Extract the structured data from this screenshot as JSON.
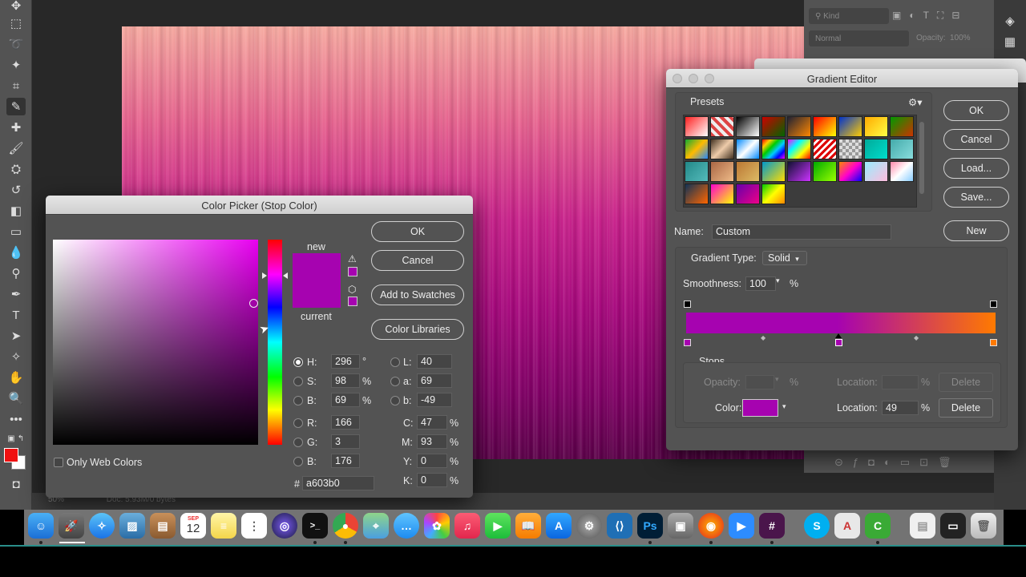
{
  "status_bar": {
    "zoom": "50%",
    "doc": "Doc: 5.93M/0 bytes"
  },
  "layers_panel": {
    "kind_label": "Kind",
    "blend_mode": "Normal",
    "opacity_label": "Opacity:",
    "opacity_value": "100%"
  },
  "color_picker": {
    "title": "Color Picker (Stop Color)",
    "new_label": "new",
    "current_label": "current",
    "ok_label": "OK",
    "cancel_label": "Cancel",
    "add_swatches_label": "Add to Swatches",
    "color_libraries_label": "Color Libraries",
    "only_web_label": "Only Web Colors",
    "fields": {
      "h": {
        "label": "H:",
        "value": "296",
        "unit": "°"
      },
      "s": {
        "label": "S:",
        "value": "98",
        "unit": "%"
      },
      "b": {
        "label": "B:",
        "value": "69",
        "unit": "%"
      },
      "r": {
        "label": "R:",
        "value": "166"
      },
      "g": {
        "label": "G:",
        "value": "3"
      },
      "bb": {
        "label": "B:",
        "value": "176"
      },
      "l": {
        "label": "L:",
        "value": "40"
      },
      "a": {
        "label": "a:",
        "value": "69"
      },
      "blab": {
        "label": "b:",
        "value": "-49"
      },
      "c": {
        "label": "C:",
        "value": "47",
        "unit": "%"
      },
      "m": {
        "label": "M:",
        "value": "93",
        "unit": "%"
      },
      "y": {
        "label": "Y:",
        "value": "0",
        "unit": "%"
      },
      "k": {
        "label": "K:",
        "value": "0",
        "unit": "%"
      }
    },
    "hex_label": "#",
    "hex_value": "a603b0",
    "color": "#a603b0"
  },
  "gradient_editor": {
    "title": "Gradient Editor",
    "presets_label": "Presets",
    "ok_label": "OK",
    "cancel_label": "Cancel",
    "load_label": "Load...",
    "save_label": "Save...",
    "new_label": "New",
    "name_label": "Name:",
    "name_value": "Custom",
    "gradient_type_label": "Gradient Type:",
    "gradient_type_value": "Solid",
    "smoothness_label": "Smoothness:",
    "smoothness_value": "100",
    "smoothness_unit": "%",
    "stops_label": "Stops",
    "opacity_label": "Opacity:",
    "opacity_unit": "%",
    "location_label": "Location:",
    "location_unit": "%",
    "delete_label": "Delete",
    "color_label": "Color:",
    "color_location_value": "49",
    "stop_color": "#a603b0",
    "end_color": "#ff7a00"
  },
  "dock": {
    "calendar_day": "12",
    "calendar_month": "SEP"
  }
}
